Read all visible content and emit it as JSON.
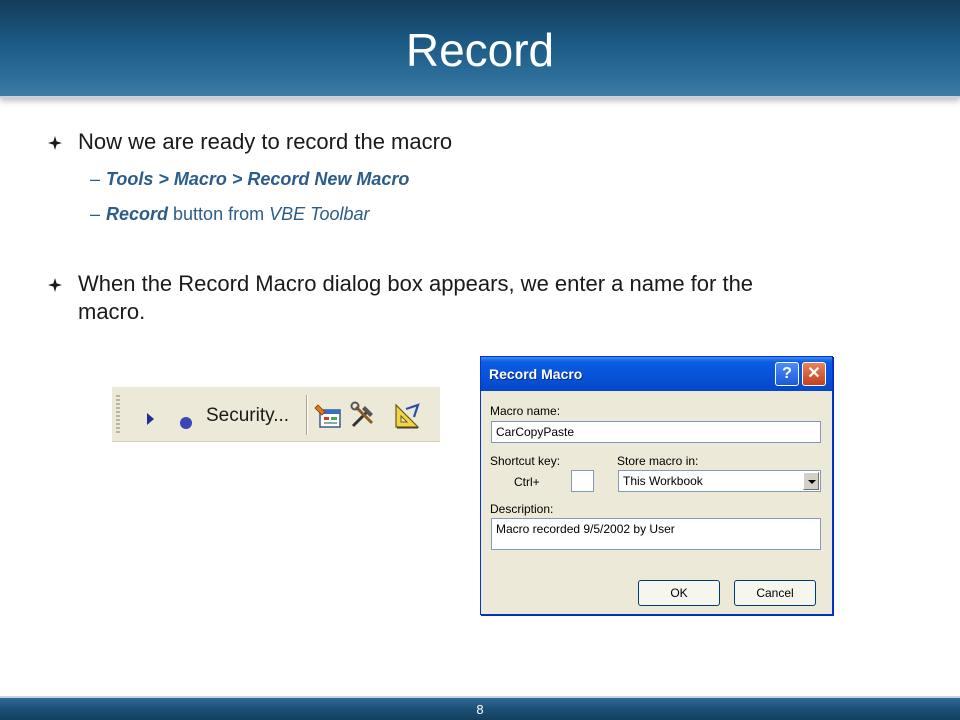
{
  "slide": {
    "title": "Record",
    "page_number": "8"
  },
  "bullets": [
    {
      "text": "Now we are ready to record the macro"
    },
    {
      "text_line1": "When the Record Macro dialog box appears, we enter a name for the",
      "text_line2": "macro."
    }
  ],
  "sub_bullets": {
    "item1": {
      "dash": "–",
      "path": "Tools > Macro > Record New Macro"
    },
    "item2": {
      "dash": "–",
      "strong": "Record",
      "middle": " button from ",
      "em": "VBE Toolbar"
    }
  },
  "toolbar": {
    "security_label": "Security...",
    "icons": [
      "run-macro-icon",
      "record-macro-icon",
      "visual-basic-editor-icon",
      "toolbox-icon",
      "design-mode-icon"
    ]
  },
  "dialog": {
    "title": "Record Macro",
    "help_glyph": "?",
    "close_glyph": "✕",
    "macro_name_label": "Macro name:",
    "macro_name_value": "CarCopyPaste",
    "shortcut_label": "Shortcut key:",
    "ctrl_prefix": "Ctrl+",
    "shortcut_value": "",
    "store_label": "Store macro in:",
    "store_value": "This Workbook",
    "description_label": "Description:",
    "description_value": "Macro recorded 9/5/2002 by User",
    "ok_label": "OK",
    "cancel_label": "Cancel"
  },
  "colors": {
    "header_blue": "#1c5a85",
    "sub_text_blue": "#2c5d8a",
    "xp_title_blue": "#0752d8",
    "dialog_face": "#ece9d8"
  }
}
